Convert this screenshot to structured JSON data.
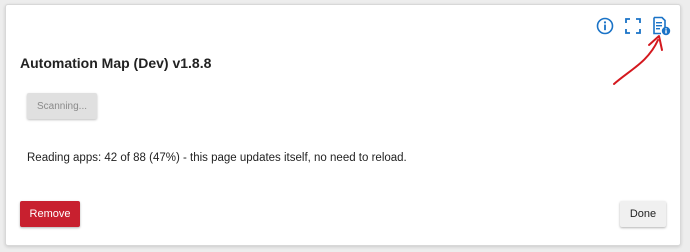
{
  "app": {
    "title": "Automation Map (Dev) v1.8.8"
  },
  "toolbar": {
    "icons": [
      "info-icon",
      "fullscreen-icon",
      "document-info-icon"
    ]
  },
  "scan_button": {
    "label": "Scanning..."
  },
  "status": {
    "text": "Reading apps: 42 of 88 (47%) - this page updates itself, no need to reload."
  },
  "actions": {
    "remove_label": "Remove",
    "done_label": "Done"
  },
  "colors": {
    "accent_blue": "#1a73c7",
    "remove_red": "#c8202f",
    "annotation_red": "#d4181e"
  }
}
